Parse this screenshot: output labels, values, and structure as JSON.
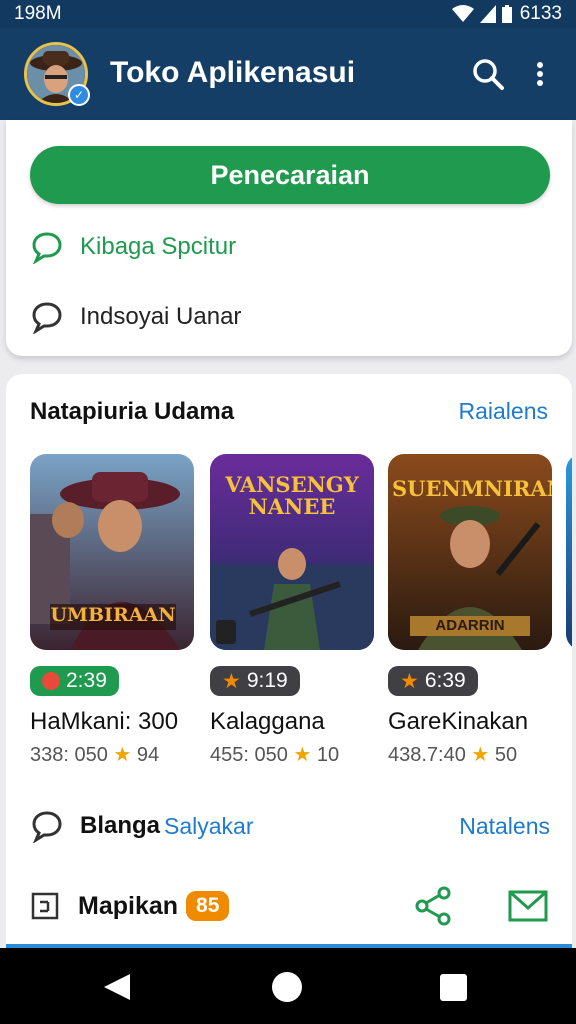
{
  "status_bar": {
    "time": "198M",
    "battery": "6133"
  },
  "app_bar": {
    "title": "Toko Aplikenasui"
  },
  "search": {
    "button_label": "Penecaraian",
    "suggestions": [
      "Kibaga Spcitur",
      "Indsoyai Uanar"
    ]
  },
  "section": {
    "title": "Natapiuria Udama",
    "see_all": "Raialens",
    "games": [
      {
        "thumb_title": "UMBIRAAN",
        "badge": "2:39",
        "name": "HaMkani: 300",
        "meta_left": "338: 050",
        "meta_right": "94"
      },
      {
        "thumb_title": "VANSENGY NANEE",
        "badge": "9:19",
        "name": "Kalaggana",
        "meta_left": "455: 050",
        "meta_right": "10"
      },
      {
        "thumb_title": "SUENMNIRAN",
        "thumb_subtitle": "ADARRIN",
        "badge": "6:39",
        "name": "GareKinakan",
        "meta_left": "438.7:40",
        "meta_right": "50"
      }
    ]
  },
  "row_blanga": {
    "label": "Blanga",
    "link": "Salyakar",
    "right_link": "Natalens"
  },
  "row_mapikan": {
    "label": "Mapikan",
    "badge": "85"
  },
  "colors": {
    "primary": "#143e66",
    "accent_green": "#1f9a4e",
    "link_blue": "#1e7bd0",
    "badge_orange": "#f08a00"
  }
}
